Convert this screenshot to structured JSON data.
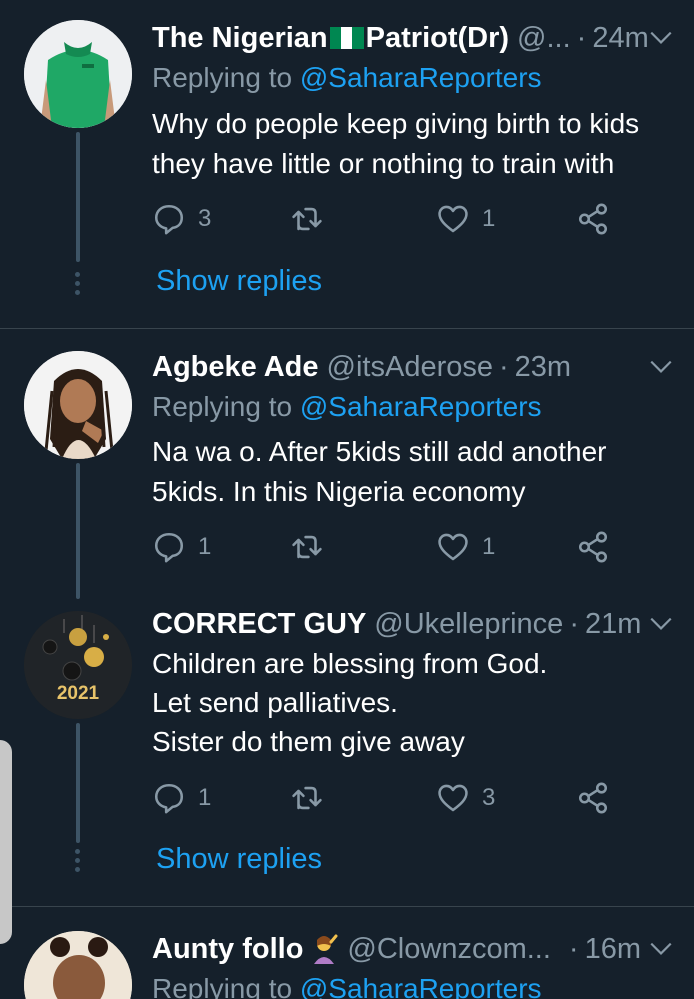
{
  "tweets": [
    {
      "name": "The Nigerian",
      "name_after_flag": "Patriot(Dr)",
      "handle": "@...",
      "time": "24m",
      "reply_prefix": "Replying to ",
      "reply_to": "@SaharaReporters",
      "text_lines": [
        "Why do people keep giving birth to kids",
        "they have little or nothing to train with"
      ],
      "replies": "3",
      "retweets": "",
      "likes": "1",
      "show_replies": "Show replies"
    },
    {
      "name": "Agbeke Ade",
      "handle": "@itsAderose",
      "time": "23m",
      "reply_prefix": "Replying to ",
      "reply_to": "@SaharaReporters",
      "text_lines": [
        "Na wa o. After 5kids still add another",
        "5kids. In this Nigeria economy"
      ],
      "replies": "1",
      "retweets": "",
      "likes": "1"
    },
    {
      "name": "CORRECT GUY",
      "handle": "@Ukelleprince",
      "time": "21m",
      "avatar_text": "2021",
      "text_lines": [
        "Children are blessing from God.",
        "Let send palliatives.",
        "Sister do them give away"
      ],
      "replies": "1",
      "retweets": "",
      "likes": "3",
      "show_replies": "Show replies"
    },
    {
      "name": "Aunty follo",
      "handle": "@Clownzcom...",
      "time": "16m",
      "reply_prefix": "Replying to ",
      "reply_to": "@SaharaReporters"
    }
  ],
  "colors": {
    "background": "#15202b",
    "accent": "#1da1f2",
    "muted": "#8899a6"
  }
}
